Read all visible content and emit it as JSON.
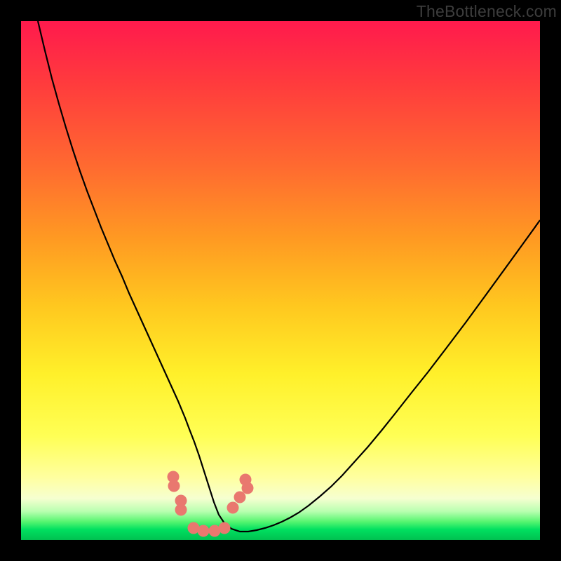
{
  "watermark": "TheBottleneck.com",
  "chart_data": {
    "type": "line",
    "title": "",
    "xlabel": "",
    "ylabel": "",
    "xlim": [
      0,
      740
    ],
    "ylim": [
      0,
      740
    ],
    "x": [
      24,
      34,
      44,
      54,
      64,
      74,
      84,
      94,
      104,
      114,
      124,
      134,
      144,
      154,
      164,
      174,
      184,
      194,
      204,
      214,
      224,
      234,
      240,
      247,
      254,
      261,
      268,
      275,
      282,
      290,
      300,
      312,
      324,
      336,
      348,
      360,
      372,
      384,
      396,
      410,
      426,
      442,
      458,
      476,
      494,
      514,
      534,
      556,
      580,
      606,
      634,
      664,
      696,
      730,
      740
    ],
    "values": [
      0,
      42,
      82,
      118,
      152,
      184,
      214,
      242,
      268,
      294,
      318,
      342,
      364,
      388,
      410,
      432,
      454,
      476,
      498,
      520,
      542,
      566,
      582,
      600,
      620,
      642,
      664,
      686,
      704,
      716,
      724,
      728,
      728,
      726,
      723,
      719,
      714,
      708,
      701,
      691,
      678,
      664,
      648,
      628,
      608,
      584,
      559,
      531,
      501,
      467,
      430,
      389,
      345,
      298,
      284
    ],
    "markers": {
      "x": [
        217,
        218,
        228,
        228,
        246,
        260,
        276,
        290,
        302,
        312,
        320,
        323
      ],
      "y": [
        650,
        663,
        684,
        697,
        723,
        727,
        727,
        723,
        694,
        679,
        654,
        666
      ]
    },
    "ytick_values_pct": [
      100,
      90,
      80,
      70,
      60,
      50,
      40,
      30,
      20,
      10,
      0
    ],
    "gradient_stops": [
      {
        "pct": 0,
        "color": "#ff1a4d"
      },
      {
        "pct": 12,
        "color": "#ff3b3d"
      },
      {
        "pct": 28,
        "color": "#ff6a30"
      },
      {
        "pct": 42,
        "color": "#ff9a22"
      },
      {
        "pct": 55,
        "color": "#ffc81f"
      },
      {
        "pct": 68,
        "color": "#fff02a"
      },
      {
        "pct": 80,
        "color": "#ffff55"
      },
      {
        "pct": 88,
        "color": "#ffffa0"
      },
      {
        "pct": 92,
        "color": "#f6ffd0"
      },
      {
        "pct": 94.5,
        "color": "#b8ffb0"
      },
      {
        "pct": 96.5,
        "color": "#55f570"
      },
      {
        "pct": 98,
        "color": "#00e060"
      },
      {
        "pct": 100,
        "color": "#00c050"
      }
    ],
    "colors": {
      "curve": "#000000",
      "marker": "#e9786f"
    }
  }
}
